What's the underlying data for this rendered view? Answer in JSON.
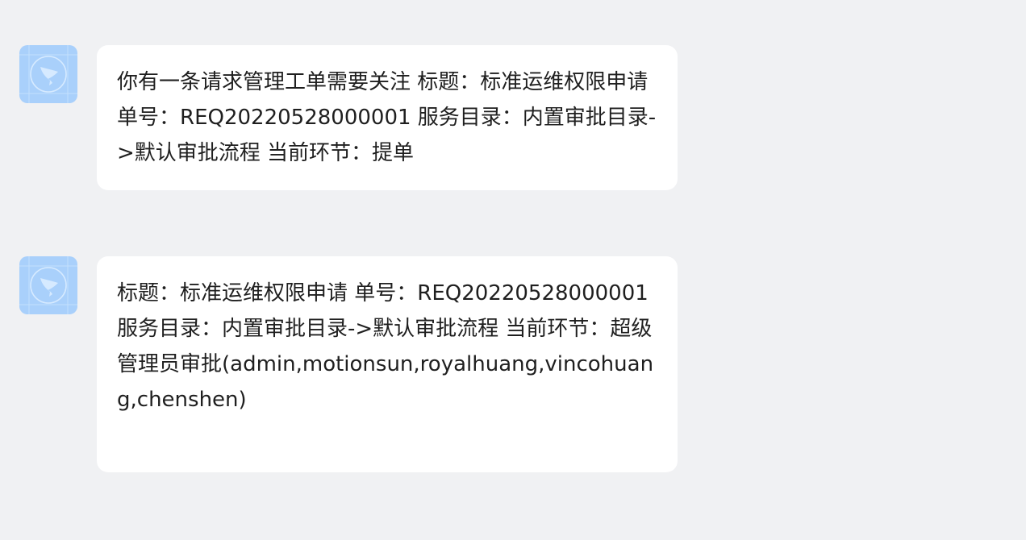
{
  "messages": [
    {
      "avatar_icon": "dingtalk-bot-icon",
      "text": "你有一条请求管理工单需要关注 标题：标准运维权限申请 单号：REQ20220528000001 服务目录：内置审批目录->默认审批流程 当前环节：提单"
    },
    {
      "avatar_icon": "dingtalk-bot-icon",
      "text": "标题：标准运维权限申请 单号：REQ20220528000001 服务目录：内置审批目录->默认审批流程 当前环节：超级管理员审批(admin,motionsun,royalhuang,vincohuang,chenshen)"
    }
  ],
  "colors": {
    "background": "#f0f1f3",
    "bubble": "#ffffff",
    "avatar": "#a9d0fb",
    "text": "#1f1f1f"
  }
}
